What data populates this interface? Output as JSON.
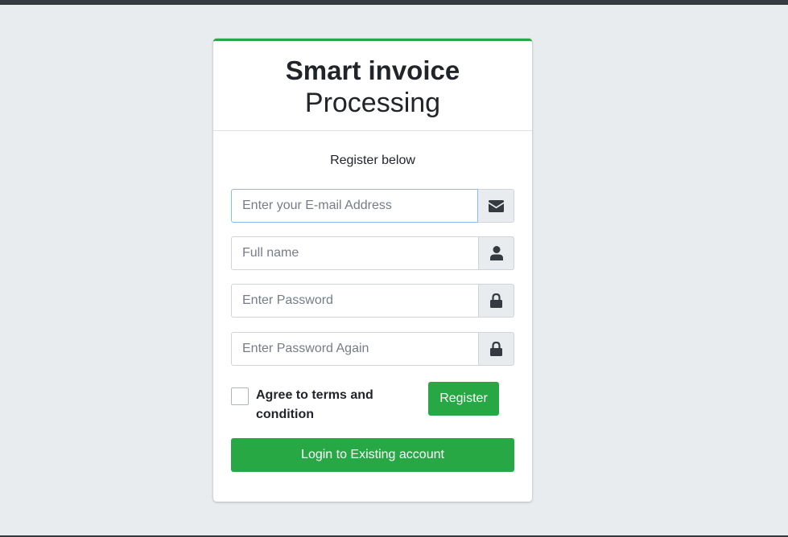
{
  "header": {
    "title_bold": "Smart invoice",
    "title_light": "Processing"
  },
  "form": {
    "subtitle": "Register below",
    "email": {
      "placeholder": "Enter your E-mail Address",
      "value": "",
      "icon": "envelope-icon"
    },
    "fullname": {
      "placeholder": "Full name",
      "value": "",
      "icon": "user-icon"
    },
    "password": {
      "placeholder": "Enter Password",
      "value": "",
      "icon": "lock-icon"
    },
    "password_again": {
      "placeholder": "Enter Password Again",
      "value": "",
      "icon": "lock-icon"
    },
    "agree_label": "Agree to terms and condition",
    "agree_checked": false,
    "register_label": "Register",
    "login_label": "Login to Existing account"
  },
  "colors": {
    "accent": "#28a745",
    "page_bg": "#e9ecef",
    "focus_border": "#80bdff"
  }
}
